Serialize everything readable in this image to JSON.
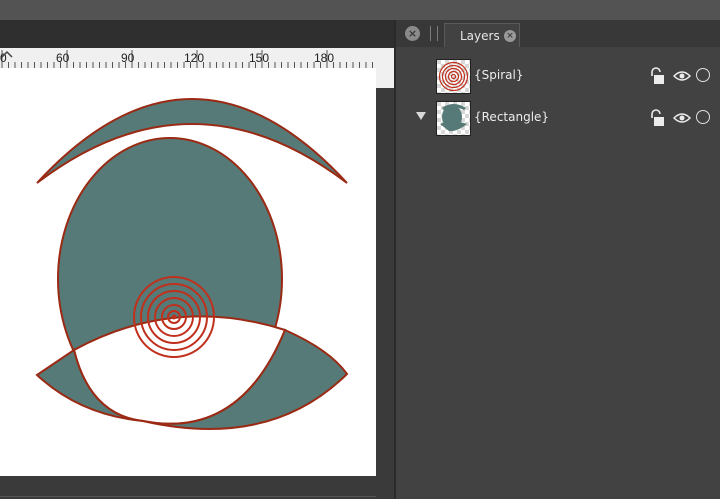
{
  "ruler": {
    "labels": [
      "0",
      "60",
      "90",
      "120",
      "150",
      "180"
    ]
  },
  "layers_panel": {
    "tab_label": "Layers",
    "close_glyph": "×",
    "layers": [
      {
        "name": "{Spiral}",
        "expanded": false
      },
      {
        "name": "{Rectangle}",
        "expanded": true
      }
    ]
  },
  "colors": {
    "shape_fill": "#557a77",
    "shape_stroke": "#9b2a14",
    "spiral_stroke": "#c0301d",
    "panel_bg": "#424242",
    "artboard": "#ffffff"
  },
  "icons": {
    "lock": "lock-icon",
    "visibility": "eye-icon",
    "select": "circle-icon",
    "expand": "triangle-down-icon",
    "close": "close-icon",
    "collapse": "chevron-up-icon"
  }
}
